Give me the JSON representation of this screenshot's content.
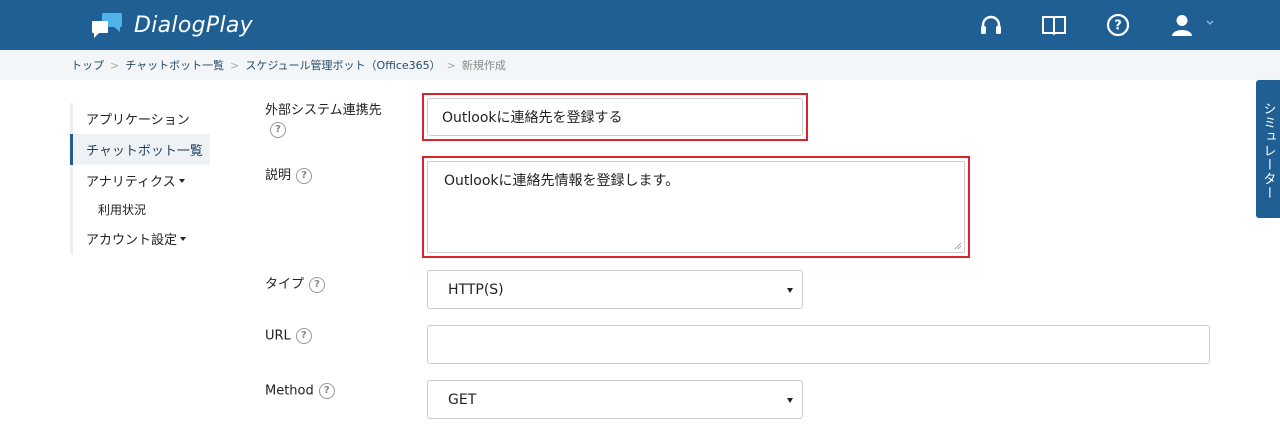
{
  "header": {
    "brand": "DialogPlay",
    "icons": [
      "headset-icon",
      "book-icon",
      "help-icon",
      "user-icon",
      "chevron-down-icon"
    ]
  },
  "breadcrumb": {
    "items": [
      "トップ",
      "チャットボット一覧",
      "スケジュール管理ボット（Office365）"
    ],
    "current": "新規作成",
    "separator": ">"
  },
  "sidebar": {
    "items": [
      {
        "label": "アプリケーション"
      },
      {
        "label": "チャットボット一覧"
      },
      {
        "label": "アナリティクス"
      },
      {
        "label": "利用状況"
      },
      {
        "label": "アカウント設定"
      }
    ]
  },
  "form": {
    "name": {
      "label": "外部システム連携先",
      "value": "Outlookに連絡先を登録する"
    },
    "description": {
      "label": "説明",
      "value": "Outlookに連絡先情報を登録します。"
    },
    "type": {
      "label": "タイプ",
      "value": "HTTP(S)"
    },
    "url": {
      "label": "URL",
      "value": ""
    },
    "method": {
      "label": "Method",
      "value": "GET"
    },
    "help_glyph": "?"
  },
  "simulator": {
    "label": "シミュレーター"
  },
  "colors": {
    "header": "#1f5f93",
    "highlight": "#d9242b"
  }
}
